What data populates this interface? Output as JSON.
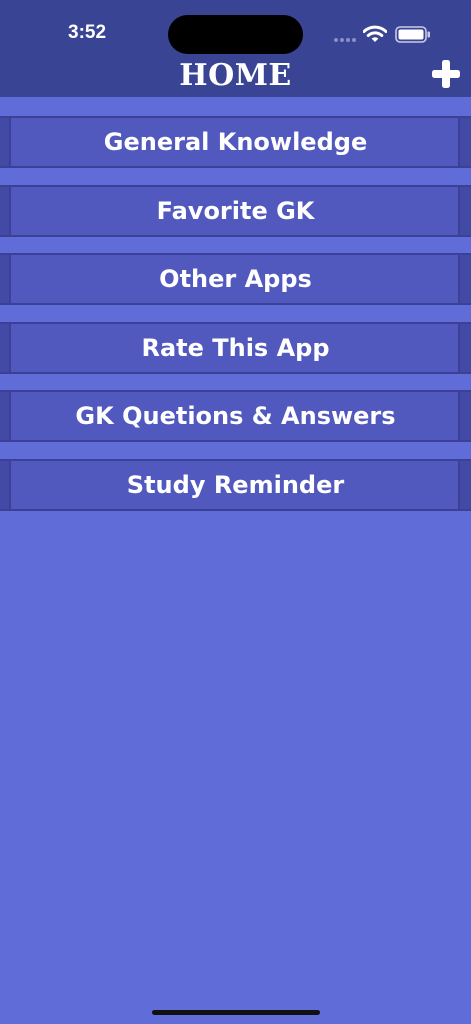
{
  "status_bar": {
    "time": "3:52"
  },
  "header": {
    "title": "HOME",
    "add_icon": "plus-icon"
  },
  "menu": {
    "items": [
      {
        "label": "General Knowledge"
      },
      {
        "label": "Favorite GK"
      },
      {
        "label": "Other Apps"
      },
      {
        "label": "Rate This App"
      },
      {
        "label": "GK Quetions & Answers"
      },
      {
        "label": "Study Reminder"
      }
    ]
  },
  "colors": {
    "background": "#606cd8",
    "header": "#3a4494",
    "menu_item": "#5158be",
    "text": "#ffffff"
  }
}
